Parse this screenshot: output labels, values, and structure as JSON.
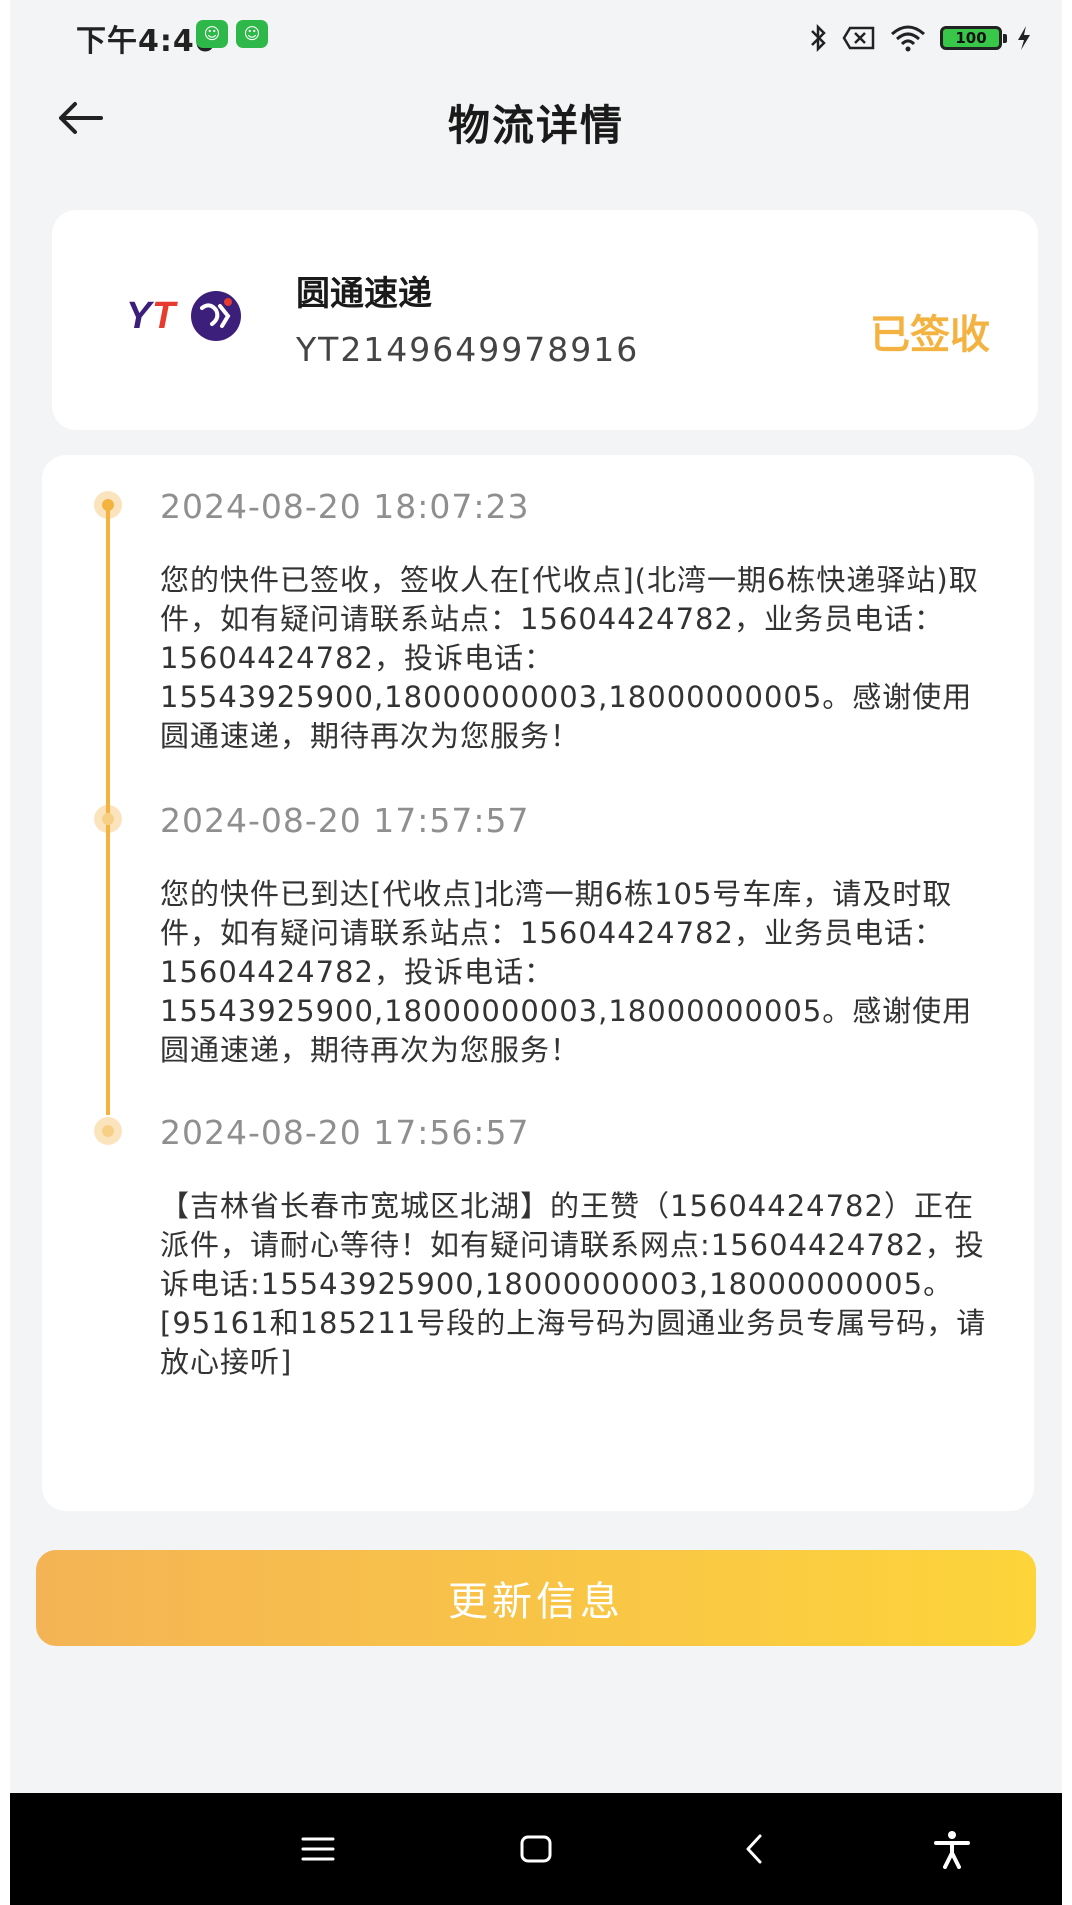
{
  "status_bar": {
    "time": "下午4:40",
    "battery": "100"
  },
  "header": {
    "title": "物流详情"
  },
  "carrier": {
    "logo_text": "YT",
    "name": "圆通速递",
    "tracking_number": "YT2149649978916",
    "status": "已签收"
  },
  "timeline": [
    {
      "time": "2024-08-20 18:07:23",
      "text": "您的快件已签收，签收人在[代收点](北湾一期6栋快递驿站)取件，如有疑问请联系站点：15604424782，业务员电话：15604424782，投诉电话：15543925900,18000000003,18000000005。感谢使用圆通速递，期待再次为您服务！"
    },
    {
      "time": "2024-08-20 17:57:57",
      "text": "您的快件已到达[代收点]北湾一期6栋105号车库，请及时取件，如有疑问请联系站点：15604424782，业务员电话：15604424782，投诉电话：15543925900,18000000003,18000000005。感谢使用圆通速递，期待再次为您服务！"
    },
    {
      "time": "2024-08-20 17:56:57",
      "text": "【吉林省长春市宽城区北湖】的王赞（15604424782）正在派件，请耐心等待！如有疑问请联系网点:15604424782，投诉电话:15543925900,18000000003,18000000005。[95161和185211号段的上海号码为圆通业务员专属号码，请放心接听]"
    }
  ],
  "actions": {
    "update_label": "更新信息"
  },
  "colors": {
    "accent": "#f4b341",
    "button_start": "#f4b455",
    "button_end": "#fdd43a",
    "background": "#f3f4f6"
  }
}
